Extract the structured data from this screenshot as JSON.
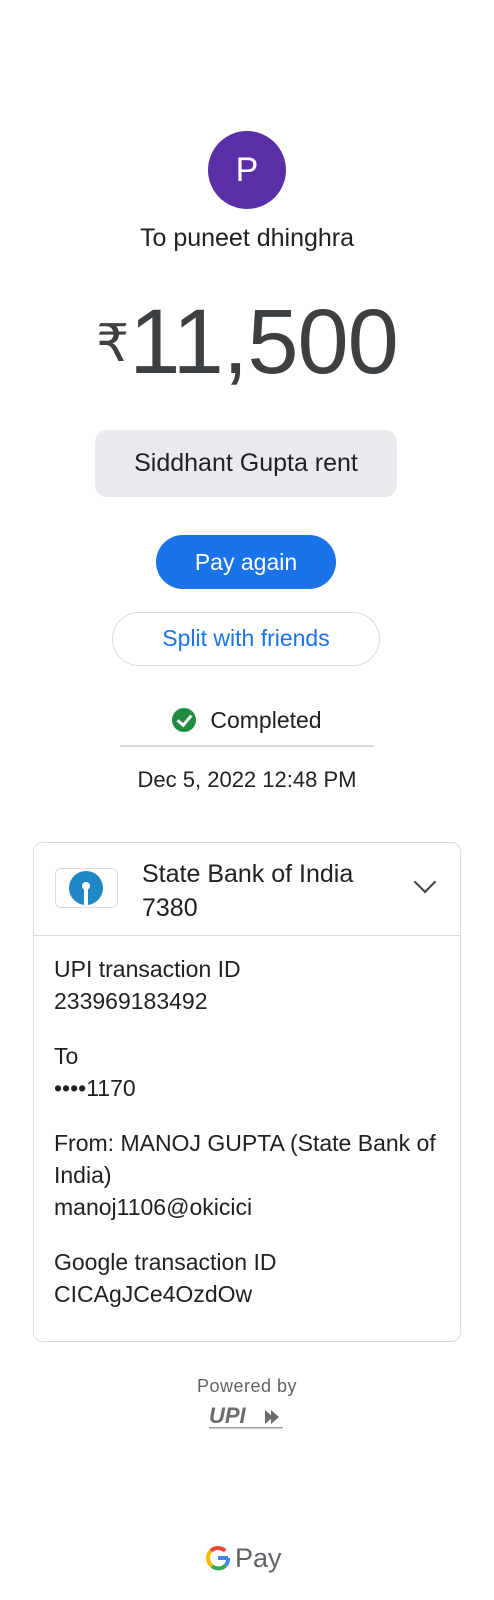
{
  "header": {
    "avatar_letter": "P",
    "recipient": "To puneet dhinghra"
  },
  "payment": {
    "currency_symbol": "₹",
    "amount": "11,500",
    "note": "Siddhant Gupta rent"
  },
  "actions": {
    "pay_again_label": "Pay again",
    "split_label": "Split with friends"
  },
  "status": {
    "label": "Completed",
    "datetime": "Dec 5, 2022 12:48 PM"
  },
  "details": {
    "bank_name": "State Bank of India",
    "bank_account_suffix": "7380",
    "upi_txn_label": "UPI transaction ID",
    "upi_txn_value": "233969183492",
    "to_label": "To",
    "to_value": "••••1170",
    "from_label": "From: MANOJ  GUPTA (State Bank of India)",
    "from_value": "manoj1106@okicici",
    "google_txn_label": "Google transaction ID",
    "google_txn_value": "CICAgJCe4OzdOw"
  },
  "footer": {
    "powered_by": "Powered by",
    "upi_logo_text": "UPI",
    "gpay_text": "Pay"
  },
  "colors": {
    "avatar": "#5a2ea6",
    "primary": "#1a73e8",
    "success": "#1e8e3e",
    "sbi_blue": "#1e88c7"
  }
}
